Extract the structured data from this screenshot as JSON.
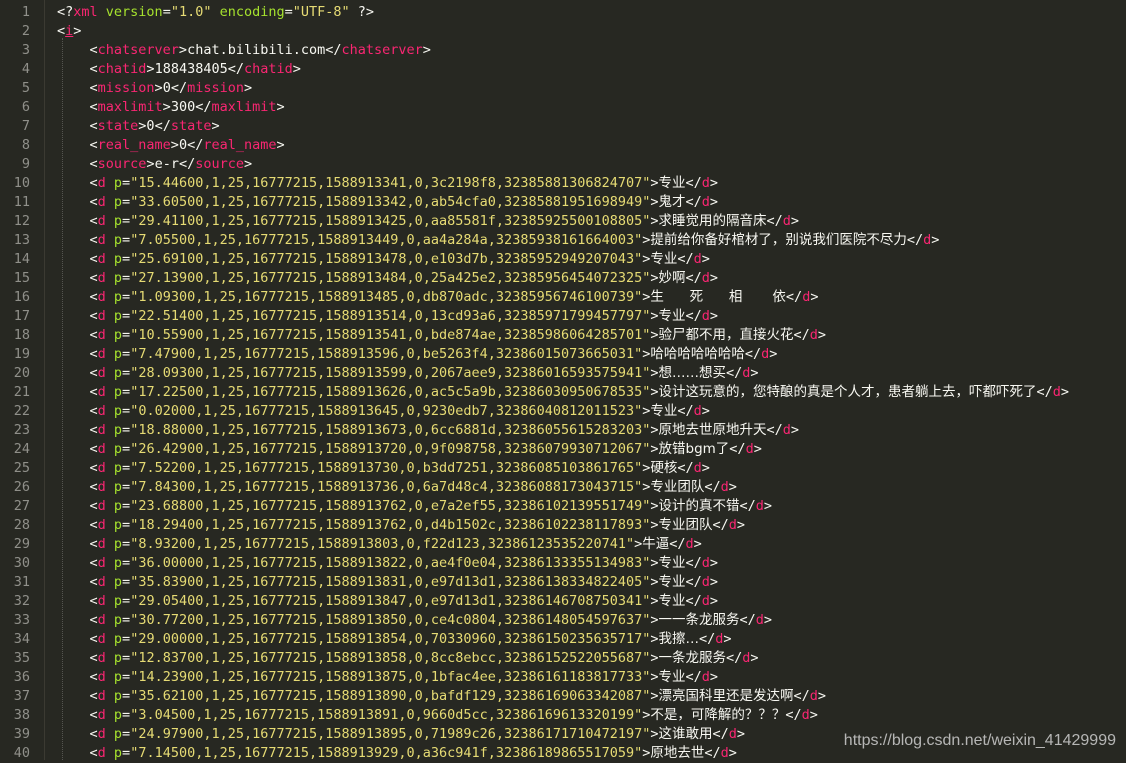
{
  "header": {
    "line1": "<?xml version=\"1.0\" encoding=\"UTF-8\" ?>",
    "root_tag": "i"
  },
  "meta": [
    {
      "tag": "chatserver",
      "value": "chat.bilibili.com"
    },
    {
      "tag": "chatid",
      "value": "188438405"
    },
    {
      "tag": "mission",
      "value": "0"
    },
    {
      "tag": "maxlimit",
      "value": "300"
    },
    {
      "tag": "state",
      "value": "0"
    },
    {
      "tag": "real_name",
      "value": "0"
    },
    {
      "tag": "source",
      "value": "e-r"
    }
  ],
  "danmaku": [
    {
      "p": "15.44600,1,25,16777215,1588913341,0,3c2198f8,32385881306824707",
      "text": "专业"
    },
    {
      "p": "33.60500,1,25,16777215,1588913342,0,ab54cfa0,32385881951698949",
      "text": "鬼才"
    },
    {
      "p": "29.41100,1,25,16777215,1588913425,0,aa85581f,32385925500108805",
      "text": "求睡觉用的隔音床"
    },
    {
      "p": "7.05500,1,25,16777215,1588913449,0,aa4a284a,32385938161664003",
      "text": "提前给你备好棺材了，别说我们医院不尽力"
    },
    {
      "p": "25.69100,1,25,16777215,1588913478,0,e103d7b,32385952949207043",
      "text": "专业"
    },
    {
      "p": "27.13900,1,25,16777215,1588913484,0,25a425e2,32385956454072325",
      "text": "妙啊"
    },
    {
      "p": "1.09300,1,25,16777215,1588913485,0,db870adc,32385956746100739",
      "text": "生      死      相       依"
    },
    {
      "p": "22.51400,1,25,16777215,1588913514,0,13cd93a6,32385971799457797",
      "text": "专业"
    },
    {
      "p": "10.55900,1,25,16777215,1588913541,0,bde874ae,32385986064285701",
      "text": "验尸都不用，直接火花"
    },
    {
      "p": "7.47900,1,25,16777215,1588913596,0,be5263f4,32386015073665031",
      "text": "哈哈哈哈哈哈哈"
    },
    {
      "p": "28.09300,1,25,16777215,1588913599,0,2067aee9,32386016593575941",
      "text": "想……想买"
    },
    {
      "p": "17.22500,1,25,16777215,1588913626,0,ac5c5a9b,32386030950678535",
      "text": "设计这玩意的，您特酿的真是个人才，患者躺上去，吓都吓死了"
    },
    {
      "p": "0.02000,1,25,16777215,1588913645,0,9230edb7,32386040812011523",
      "text": "专业"
    },
    {
      "p": "18.88000,1,25,16777215,1588913673,0,6cc6881d,32386055615283203",
      "text": "原地去世原地升天"
    },
    {
      "p": "26.42900,1,25,16777215,1588913720,0,9f098758,32386079930712067",
      "text": "放错bgm了"
    },
    {
      "p": "7.52200,1,25,16777215,1588913730,0,b3dd7251,32386085103861765",
      "text": "硬核"
    },
    {
      "p": "7.84300,1,25,16777215,1588913736,0,6a7d48c4,32386088173043715",
      "text": "专业团队"
    },
    {
      "p": "23.68800,1,25,16777215,1588913762,0,e7a2ef55,32386102139551749",
      "text": "设计的真不错"
    },
    {
      "p": "18.29400,1,25,16777215,1588913762,0,d4b1502c,32386102238117893",
      "text": "专业团队"
    },
    {
      "p": "8.93200,1,25,16777215,1588913803,0,f22d123,32386123535220741",
      "text": "牛逼"
    },
    {
      "p": "36.00000,1,25,16777215,1588913822,0,ae4f0e04,32386133355134983",
      "text": "专业"
    },
    {
      "p": "35.83900,1,25,16777215,1588913831,0,e97d13d1,32386138334822405",
      "text": "专业"
    },
    {
      "p": "29.05400,1,25,16777215,1588913847,0,e97d13d1,32386146708750341",
      "text": "专业"
    },
    {
      "p": "30.77200,1,25,16777215,1588913850,0,ce4c0804,32386148054597637",
      "text": "一一条龙服务"
    },
    {
      "p": "29.00000,1,25,16777215,1588913854,0,70330960,32386150235635717",
      "text": "我擦…"
    },
    {
      "p": "12.83700,1,25,16777215,1588913858,0,8cc8ebcc,32386152522055687",
      "text": "一条龙服务"
    },
    {
      "p": "14.23900,1,25,16777215,1588913875,0,1bfac4ee,32386161183817733",
      "text": "专业"
    },
    {
      "p": "35.62100,1,25,16777215,1588913890,0,bafdf129,32386169063342087",
      "text": "漂亮国科里还是发达啊"
    },
    {
      "p": "3.04500,1,25,16777215,1588913891,0,9660d5cc,32386169613320199",
      "text": "不是，可降解的？？？"
    },
    {
      "p": "24.97900,1,25,16777215,1588913895,0,71989c26,32386171710472197",
      "text": "这谁敢用"
    },
    {
      "p": "7.14500,1,25,16777215,1588913929,0,a36c941f,32386189865517059",
      "text": "原地去世"
    }
  ],
  "watermark": "https://blog.csdn.net/weixin_41429999",
  "colors": {
    "background": "#272822",
    "tag": "#f92672",
    "attribute": "#a6e22e",
    "string": "#e6db74",
    "text": "#f8f8f2",
    "line_number": "#90908a"
  }
}
